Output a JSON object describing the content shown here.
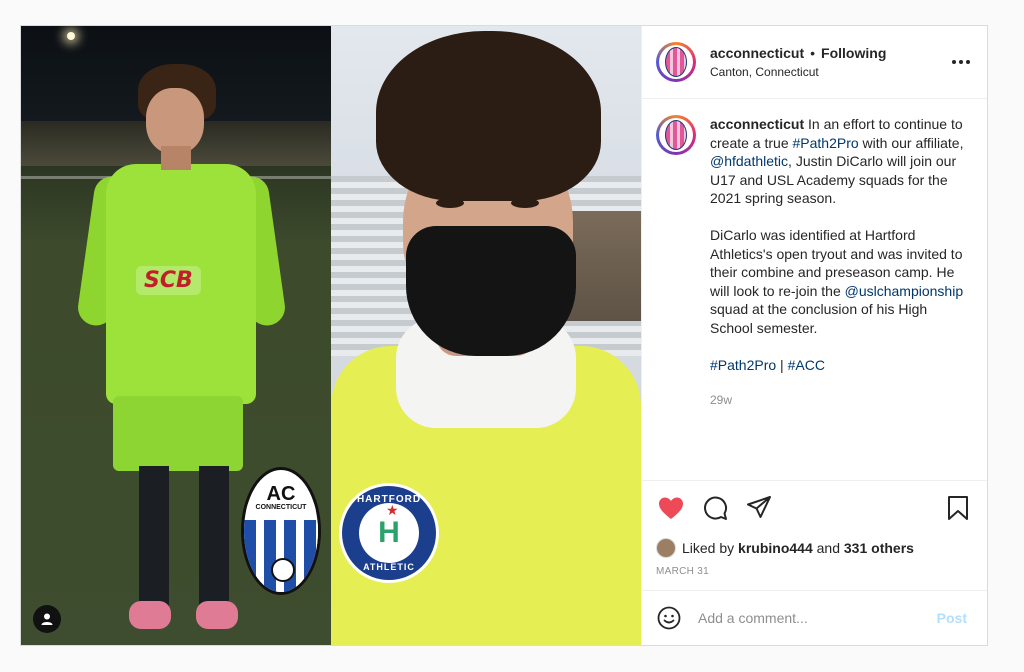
{
  "colors": {
    "like_red": "#ed4956",
    "link_blue": "#00376b",
    "muted_gray": "#8e8e8e",
    "post_disabled": "#b2dffc",
    "jersey_green": "#9de23a",
    "bib_yellow": "#e5ee52"
  },
  "media": {
    "left_photo": {
      "sponsor_text": "SCB",
      "badge_title": "AC",
      "badge_subtitle": "CONNECTICUT"
    },
    "right_photo": {
      "badge_top": "HARTFORD",
      "badge_letter": "H",
      "badge_bottom": "ATHLETIC"
    },
    "profile_icon": "user-icon"
  },
  "header": {
    "username": "acconnecticut",
    "separator": "•",
    "follow_status": "Following",
    "location": "Canton, Connecticut",
    "more_icon": "more-horizontal-icon"
  },
  "caption": {
    "username": "acconnecticut",
    "p1_a": " In an effort to continue to create a true ",
    "p1_tag1": "#Path2Pro",
    "p1_b": " with our affiliate, ",
    "p1_mention1": "@hfdathletic",
    "p1_c": ", Justin DiCarlo will join our U17 and USL Academy squads for the 2021 spring season.",
    "p2_a": "DiCarlo was identified at Hartford Athletics's open tryout and was invited to their combine and preseason camp. He will look to re-join the ",
    "p2_mention": "@uslchampionship",
    "p2_b": " squad at the conclusion of his High School semester.",
    "p3_tag1": "#Path2Pro",
    "p3_sep": " | ",
    "p3_tag2": "#ACC",
    "age": "29w"
  },
  "actions": {
    "like_icon": "heart-filled-icon",
    "comment_icon": "comment-icon",
    "share_icon": "paper-plane-icon",
    "save_icon": "bookmark-icon"
  },
  "likes": {
    "prefix": "Liked by ",
    "user": "krubino444",
    "middle": " and ",
    "others": "331 others"
  },
  "date": "MARCH 31",
  "comment": {
    "emoji_icon": "smiley-icon",
    "placeholder": "Add a comment...",
    "post_label": "Post"
  }
}
